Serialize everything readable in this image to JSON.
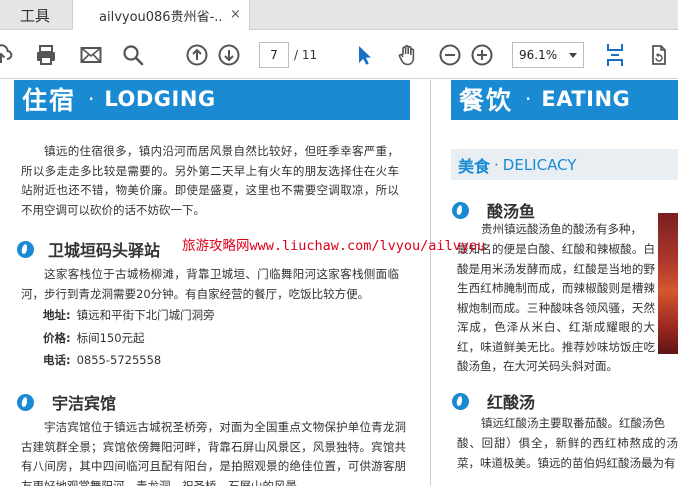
{
  "tabs": {
    "tools": "工具",
    "doc_title": "ailvyou086贵州省-...",
    "close": "×"
  },
  "toolbar": {
    "page_current": "7",
    "page_total": "/ 11",
    "zoom": "96.1%"
  },
  "left": {
    "banner_cn": "住宿",
    "banner_dot": "·",
    "banner_en": "LODGING",
    "intro": "镇远的住宿很多，镇内沿河而居风景自然比较好，但旺季幸客严重，所以多走走多比较是需要的。另外第二天早上有火车的朋友选择住在火车站附近也还不错，物美价廉。即使是盛夏，这里也不需要空调取凉，所以不用空调可以砍价的话不妨砍一下。",
    "hotel1": {
      "name": "卫城垣码头驿站",
      "desc": "这家客栈位于古城杨柳滩，背靠卫城垣、门临舞阳河这家客栈侧面临河，步行到青龙洞需要20分钟。有自家经营的餐厅，吃饭比较方便。",
      "addr_label": "地址:",
      "addr": "镇远和平街下北门城门洞旁",
      "price_label": "价格:",
      "price": "标间150元起",
      "phone_label": "电话:",
      "phone": "0855-5725558"
    },
    "hotel2": {
      "name": "宇洁宾馆",
      "desc": "宇洁宾馆位于镇远古城祝圣桥旁，对面为全国重点文物保护单位青龙洞古建筑群全景；宾馆依傍舞阳河畔，背靠石屏山风景区，风景独特。宾馆共有八间房，其中四间临河且配有阳台，是拍照观景的绝佳位置，可供游客朋友更好地观赏舞阳河、青龙洞、祝圣桥、石屏山的风景。"
    }
  },
  "right": {
    "banner_cn": "餐饮",
    "banner_dot": "·",
    "banner_en": "EATING",
    "sub_cn": "美食",
    "sub_dot": "·",
    "sub_en": "DELICACY",
    "dish1": {
      "name": "酸汤鱼",
      "desc_first": "贵州镇远酸汤鱼的酸汤有多种，",
      "desc_rest": "最知名的便是白酸、红酸和辣椒酸。白酸是用米汤发酵而成，红酸是当地的野生西红柿腌制而成，而辣椒酸则是槽辣椒炮制而成。三种酸味各领风骚，天然浑成，色泽从米白、红渐成耀眼的大红，味道鲜美无比。推荐妙味坊饭庄吃酸汤鱼，在大河关码头斜对面。"
    },
    "dish2": {
      "name": "红酸汤",
      "desc_first": "镇远红酸汤主要取番茄酸。红酸汤色",
      "desc_rest": "酸、回甜）俱全，新鲜的西红柿熬成的汤菜，味道极美。镇远的苗伯妈红酸汤最为有"
    }
  },
  "watermark": "旅游攻略网www.liuchaw.com/lvyou/ailvyou"
}
